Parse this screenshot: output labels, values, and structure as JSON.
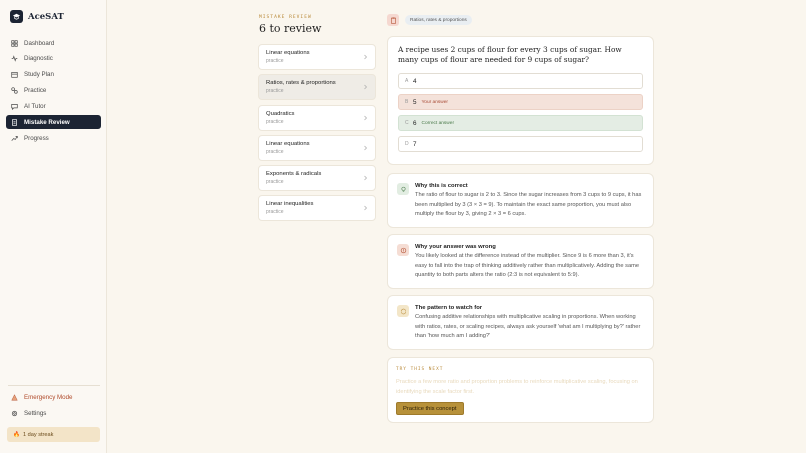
{
  "app": {
    "name": "AceSAT"
  },
  "sidebar": {
    "items": [
      {
        "label": "Dashboard",
        "icon": "dashboard-icon"
      },
      {
        "label": "Diagnostic",
        "icon": "diagnostic-icon"
      },
      {
        "label": "Study Plan",
        "icon": "calendar-icon"
      },
      {
        "label": "Practice",
        "icon": "practice-icon"
      },
      {
        "label": "AI Tutor",
        "icon": "chat-icon"
      },
      {
        "label": "Mistake Review",
        "icon": "review-icon",
        "active": true
      },
      {
        "label": "Progress",
        "icon": "trend-icon"
      }
    ],
    "bottom": [
      {
        "label": "Emergency Mode",
        "icon": "alert-icon"
      },
      {
        "label": "Settings",
        "icon": "gear-icon"
      }
    ],
    "streak": "1 day streak"
  },
  "review": {
    "eyebrow": "MISTAKE REVIEW",
    "heading": "6 to review",
    "items": [
      {
        "title": "Linear equations",
        "sub": "practice"
      },
      {
        "title": "Ratios, rates & proportions",
        "sub": "practice",
        "selected": true
      },
      {
        "title": "Quadratics",
        "sub": "practice"
      },
      {
        "title": "Linear equations",
        "sub": "practice"
      },
      {
        "title": "Exponents & radicals",
        "sub": "practice"
      },
      {
        "title": "Linear inequalities",
        "sub": "practice"
      }
    ]
  },
  "detail": {
    "topic": "Ratios, rates & proportions",
    "question": "A recipe uses 2 cups of flour for every 3 cups of sugar. How many cups of flour are needed for 9 cups of sugar?",
    "choices": [
      {
        "letter": "A",
        "value": "4",
        "note": ""
      },
      {
        "letter": "B",
        "value": "5",
        "note": "Your answer",
        "state": "wrong"
      },
      {
        "letter": "C",
        "value": "6",
        "note": "Correct answer",
        "state": "right"
      },
      {
        "letter": "D",
        "value": "7",
        "note": ""
      }
    ],
    "why_correct": {
      "title": "Why this is correct",
      "body": "The ratio of flour to sugar is 2 to 3. Since the sugar increases from 3 cups to 9 cups, it has been multiplied by 3 (3 × 3 = 9). To maintain the exact same proportion, you must also multiply the flour by 3, giving 2 × 3 = 6 cups."
    },
    "why_wrong": {
      "title": "Why your answer was wrong",
      "body": "You likely looked at the difference instead of the multiplier. Since 9 is 6 more than 3, it's easy to fall into the trap of thinking additively rather than multiplicatively. Adding the same quantity to both parts alters the ratio (2:3 is not equivalent to 5:9)."
    },
    "pattern": {
      "title": "The pattern to watch for",
      "body": "Confusing additive relationships with multiplicative scaling in proportions. When working with ratios, rates, or scaling recipes, always ask yourself 'what am I multiplying by?' rather than 'how much am I adding?'"
    },
    "try_next": {
      "eyebrow": "TRY THIS NEXT",
      "body": "Practice a few more ratio and proportion problems to reinforce multiplicative scaling, focusing on identifying the scale factor first.",
      "button": "Practice this concept"
    }
  },
  "colors": {
    "accent": "#1c2433",
    "gold": "#b7913a",
    "wrong": "#f4e2da",
    "right": "#e4ede4"
  }
}
